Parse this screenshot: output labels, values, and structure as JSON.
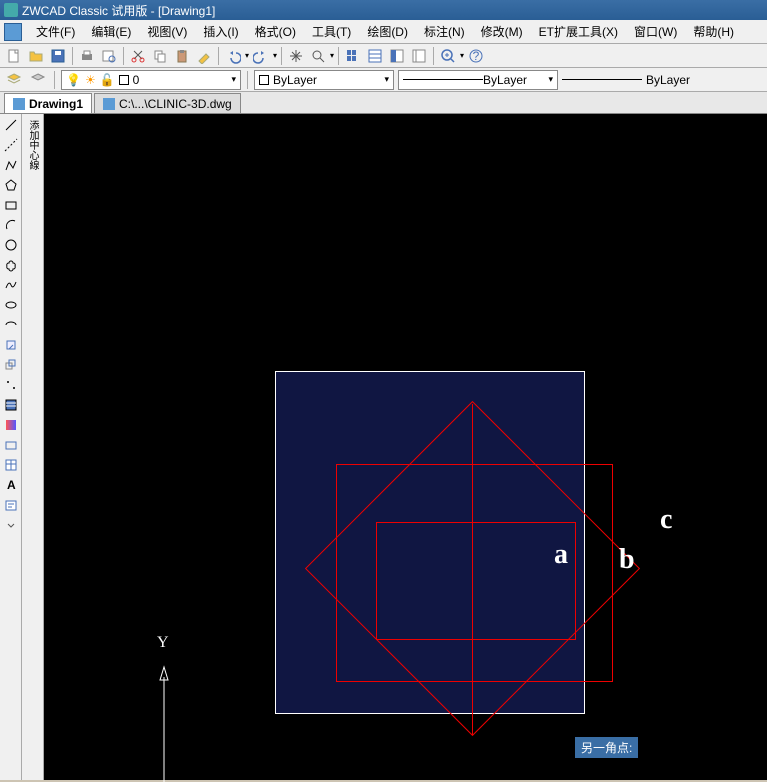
{
  "window": {
    "title": "ZWCAD Classic 试用版 - [Drawing1]"
  },
  "menu": {
    "items": [
      {
        "label": "文件(F)"
      },
      {
        "label": "编辑(E)"
      },
      {
        "label": "视图(V)"
      },
      {
        "label": "插入(I)"
      },
      {
        "label": "格式(O)"
      },
      {
        "label": "工具(T)"
      },
      {
        "label": "绘图(D)"
      },
      {
        "label": "标注(N)"
      },
      {
        "label": "修改(M)"
      },
      {
        "label": "ET扩展工具(X)"
      },
      {
        "label": "窗口(W)"
      },
      {
        "label": "帮助(H)"
      }
    ]
  },
  "layer": {
    "current": "0",
    "linetype": "ByLayer",
    "lineweight": "ByLayer",
    "plotstyle": "ByLayer"
  },
  "tabs": [
    {
      "label": "Drawing1",
      "active": true
    },
    {
      "label": "C:\\...\\CLINIC-3D.dwg",
      "active": false
    }
  ],
  "prompt": {
    "text": "另一角点:"
  },
  "annotations": {
    "a": "a",
    "b": "b",
    "c": "c",
    "y": "Y"
  },
  "lefttools2_label": "添加中心線",
  "icons": {
    "new": "new",
    "open": "open",
    "save": "save",
    "print": "print",
    "cut": "cut",
    "copy": "copy",
    "paste": "paste",
    "undo": "undo",
    "redo": "redo",
    "pan": "pan",
    "zoomext": "zoomext",
    "zoom": "zoom",
    "props": "props"
  }
}
